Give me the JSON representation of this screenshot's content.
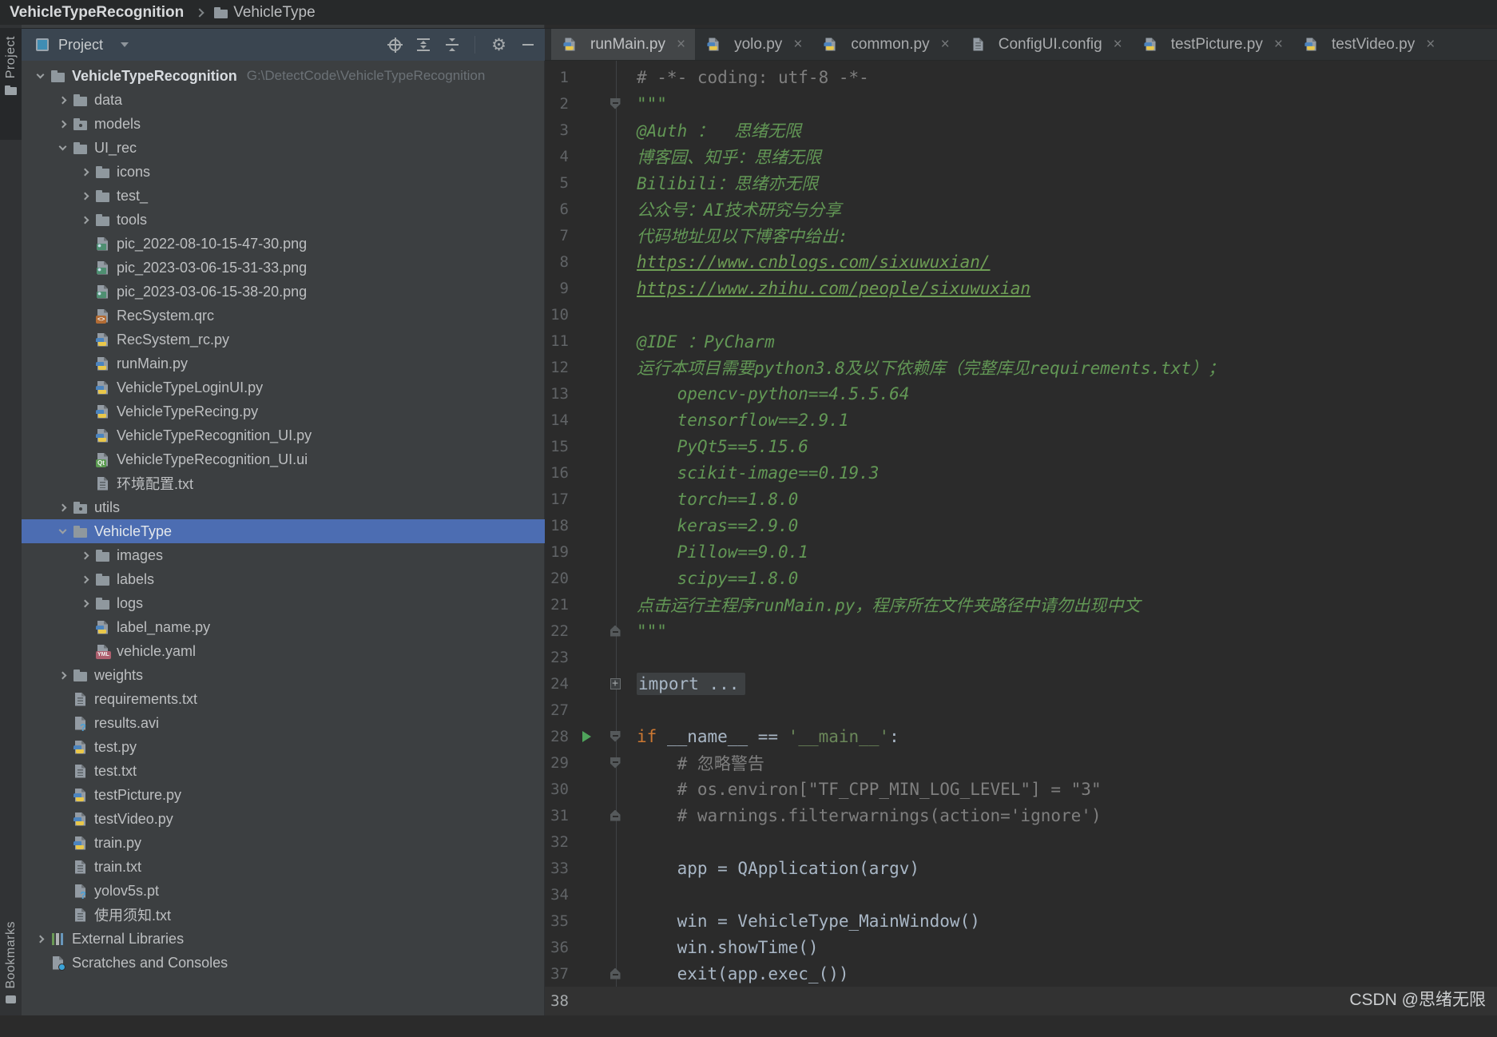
{
  "breadcrumb": {
    "project": "VehicleTypeRecognition",
    "current": "VehicleType"
  },
  "left_strip": {
    "top_label": "Project",
    "bottom_label": "Bookmarks"
  },
  "project_panel": {
    "title": "Project",
    "tools": [
      "locate-icon",
      "expand-all-icon",
      "collapse-all-icon",
      "settings-gear-icon",
      "hide-panel-icon"
    ],
    "root_path": "G:\\DetectCode\\VehicleTypeRecognition",
    "tree": [
      {
        "label": "VehicleTypeRecognition",
        "depth": 0,
        "chev": "e",
        "icon": "folder",
        "bold": true,
        "path": "G:\\DetectCode\\VehicleTypeRecognition"
      },
      {
        "label": "data",
        "depth": 1,
        "chev": "c",
        "icon": "folder"
      },
      {
        "label": "models",
        "depth": 1,
        "chev": "c",
        "icon": "folder-pkg"
      },
      {
        "label": "UI_rec",
        "depth": 1,
        "chev": "e",
        "icon": "folder"
      },
      {
        "label": "icons",
        "depth": 2,
        "chev": "c",
        "icon": "folder"
      },
      {
        "label": "test_",
        "depth": 2,
        "chev": "c",
        "icon": "folder"
      },
      {
        "label": "tools",
        "depth": 2,
        "chev": "c",
        "icon": "folder"
      },
      {
        "label": "pic_2022-08-10-15-47-30.png",
        "depth": 2,
        "chev": "n",
        "icon": "png"
      },
      {
        "label": "pic_2023-03-06-15-31-33.png",
        "depth": 2,
        "chev": "n",
        "icon": "png"
      },
      {
        "label": "pic_2023-03-06-15-38-20.png",
        "depth": 2,
        "chev": "n",
        "icon": "png"
      },
      {
        "label": "RecSystem.qrc",
        "depth": 2,
        "chev": "n",
        "icon": "qrc"
      },
      {
        "label": "RecSystem_rc.py",
        "depth": 2,
        "chev": "n",
        "icon": "py"
      },
      {
        "label": "runMain.py",
        "depth": 2,
        "chev": "n",
        "icon": "py"
      },
      {
        "label": "VehicleTypeLoginUI.py",
        "depth": 2,
        "chev": "n",
        "icon": "py"
      },
      {
        "label": "VehicleTypeRecing.py",
        "depth": 2,
        "chev": "n",
        "icon": "py"
      },
      {
        "label": "VehicleTypeRecognition_UI.py",
        "depth": 2,
        "chev": "n",
        "icon": "py"
      },
      {
        "label": "VehicleTypeRecognition_UI.ui",
        "depth": 2,
        "chev": "n",
        "icon": "ui"
      },
      {
        "label": "环境配置.txt",
        "depth": 2,
        "chev": "n",
        "icon": "txt"
      },
      {
        "label": "utils",
        "depth": 1,
        "chev": "c",
        "icon": "folder-pkg"
      },
      {
        "label": "VehicleType",
        "depth": 1,
        "chev": "e",
        "icon": "folder",
        "selected": true
      },
      {
        "label": "images",
        "depth": 2,
        "chev": "c",
        "icon": "folder"
      },
      {
        "label": "labels",
        "depth": 2,
        "chev": "c",
        "icon": "folder"
      },
      {
        "label": "logs",
        "depth": 2,
        "chev": "c",
        "icon": "folder"
      },
      {
        "label": "label_name.py",
        "depth": 2,
        "chev": "n",
        "icon": "py"
      },
      {
        "label": "vehicle.yaml",
        "depth": 2,
        "chev": "n",
        "icon": "yaml"
      },
      {
        "label": "weights",
        "depth": 1,
        "chev": "c",
        "icon": "folder"
      },
      {
        "label": "requirements.txt",
        "depth": 1,
        "chev": "n",
        "icon": "txt"
      },
      {
        "label": "results.avi",
        "depth": 1,
        "chev": "n",
        "icon": "unknown"
      },
      {
        "label": "test.py",
        "depth": 1,
        "chev": "n",
        "icon": "py"
      },
      {
        "label": "test.txt",
        "depth": 1,
        "chev": "n",
        "icon": "txt"
      },
      {
        "label": "testPicture.py",
        "depth": 1,
        "chev": "n",
        "icon": "py"
      },
      {
        "label": "testVideo.py",
        "depth": 1,
        "chev": "n",
        "icon": "py"
      },
      {
        "label": "train.py",
        "depth": 1,
        "chev": "n",
        "icon": "py"
      },
      {
        "label": "train.txt",
        "depth": 1,
        "chev": "n",
        "icon": "txt"
      },
      {
        "label": "yolov5s.pt",
        "depth": 1,
        "chev": "n",
        "icon": "unknown"
      },
      {
        "label": "使用须知.txt",
        "depth": 1,
        "chev": "n",
        "icon": "txt"
      },
      {
        "label": "External Libraries",
        "depth": 0,
        "chev": "c",
        "icon": "lib"
      },
      {
        "label": "Scratches and Consoles",
        "depth": 0,
        "chev": "n",
        "icon": "scratch"
      }
    ]
  },
  "tabs": [
    {
      "label": "runMain.py",
      "icon": "py",
      "active": true
    },
    {
      "label": "yolo.py",
      "icon": "py",
      "active": false
    },
    {
      "label": "common.py",
      "icon": "py",
      "active": false
    },
    {
      "label": "ConfigUI.config",
      "icon": "config",
      "active": false
    },
    {
      "label": "testPicture.py",
      "icon": "py",
      "active": false
    },
    {
      "label": "testVideo.py",
      "icon": "py",
      "active": false
    }
  ],
  "editor": {
    "lines": [
      {
        "num": "1",
        "g": "",
        "seg": [
          [
            "# -*- coding: utf-8 -*-",
            "c"
          ]
        ]
      },
      {
        "num": "2",
        "g": "down",
        "seg": [
          [
            "\"\"\"",
            "d"
          ]
        ]
      },
      {
        "num": "3",
        "g": "",
        "seg": [
          [
            "@Auth ：  思绪无限",
            "d"
          ]
        ]
      },
      {
        "num": "4",
        "g": "",
        "seg": [
          [
            "博客园、知乎：思绪无限",
            "d"
          ]
        ]
      },
      {
        "num": "5",
        "g": "",
        "seg": [
          [
            "Bilibili：思绪亦无限",
            "d"
          ]
        ]
      },
      {
        "num": "6",
        "g": "",
        "seg": [
          [
            "公众号：AI技术研究与分享",
            "d"
          ]
        ]
      },
      {
        "num": "7",
        "g": "",
        "seg": [
          [
            "代码地址见以下博客中给出:",
            "d"
          ]
        ]
      },
      {
        "num": "8",
        "g": "",
        "seg": [
          [
            "https://www.cnblogs.com/sixuwuxian/",
            "l"
          ]
        ]
      },
      {
        "num": "9",
        "g": "",
        "seg": [
          [
            "https://www.zhihu.com/people/sixuwuxian",
            "l"
          ]
        ]
      },
      {
        "num": "10",
        "g": "",
        "seg": []
      },
      {
        "num": "11",
        "g": "",
        "seg": [
          [
            "@IDE ：PyCharm",
            "d"
          ]
        ]
      },
      {
        "num": "12",
        "g": "",
        "seg": [
          [
            "运行本项目需要python3.8及以下依赖库（完整库见requirements.txt）；",
            "d"
          ]
        ]
      },
      {
        "num": "13",
        "g": "",
        "seg": [
          [
            "    opencv-python==4.5.5.64",
            "d"
          ]
        ]
      },
      {
        "num": "14",
        "g": "",
        "seg": [
          [
            "    tensorflow==2.9.1",
            "d"
          ]
        ]
      },
      {
        "num": "15",
        "g": "",
        "seg": [
          [
            "    PyQt5==5.15.6",
            "d"
          ]
        ]
      },
      {
        "num": "16",
        "g": "",
        "seg": [
          [
            "    scikit-image==0.19.3",
            "d"
          ]
        ]
      },
      {
        "num": "17",
        "g": "",
        "seg": [
          [
            "    torch==1.8.0",
            "d"
          ]
        ]
      },
      {
        "num": "18",
        "g": "",
        "seg": [
          [
            "    keras==2.9.0",
            "d"
          ]
        ]
      },
      {
        "num": "19",
        "g": "",
        "seg": [
          [
            "    Pillow==9.0.1",
            "d"
          ]
        ]
      },
      {
        "num": "20",
        "g": "",
        "seg": [
          [
            "    scipy==1.8.0",
            "d"
          ]
        ]
      },
      {
        "num": "21",
        "g": "",
        "seg": [
          [
            "点击运行主程序runMain.py，程序所在文件夹路径中请勿出现中文",
            "d"
          ]
        ]
      },
      {
        "num": "22",
        "g": "up",
        "seg": [
          [
            "\"\"\"",
            "d"
          ]
        ]
      },
      {
        "num": "23",
        "g": "",
        "seg": []
      },
      {
        "num": "24",
        "g": "plus",
        "seg": [
          [
            "import ...",
            "f"
          ]
        ]
      },
      {
        "num": "27",
        "g": "",
        "seg": []
      },
      {
        "num": "28",
        "g": "down",
        "run": true,
        "seg": [
          [
            "if",
            "k"
          ],
          [
            " __name__ == ",
            "t"
          ],
          [
            "'__main__'",
            "s"
          ],
          [
            ":",
            "t"
          ]
        ]
      },
      {
        "num": "29",
        "g": "down",
        "seg": [
          [
            "    # 忽略警告",
            "c"
          ]
        ]
      },
      {
        "num": "30",
        "g": "",
        "seg": [
          [
            "    # os.environ[\"TF_CPP_MIN_LOG_LEVEL\"] = \"3\"",
            "c"
          ]
        ]
      },
      {
        "num": "31",
        "g": "up",
        "seg": [
          [
            "    # warnings.filterwarnings(action='ignore')",
            "c"
          ]
        ]
      },
      {
        "num": "32",
        "g": "",
        "seg": []
      },
      {
        "num": "33",
        "g": "",
        "seg": [
          [
            "    app = QApplication(argv)",
            "t"
          ]
        ]
      },
      {
        "num": "34",
        "g": "",
        "seg": []
      },
      {
        "num": "35",
        "g": "",
        "seg": [
          [
            "    win = VehicleType_MainWindow()",
            "t"
          ]
        ]
      },
      {
        "num": "36",
        "g": "",
        "seg": [
          [
            "    win.showTime()",
            "t"
          ]
        ]
      },
      {
        "num": "37",
        "g": "up",
        "seg": [
          [
            "    exit(app.exec_())",
            "t"
          ]
        ]
      },
      {
        "num": "38",
        "g": "",
        "caret": true,
        "seg": []
      }
    ]
  },
  "watermark": "CSDN @思绪无限"
}
